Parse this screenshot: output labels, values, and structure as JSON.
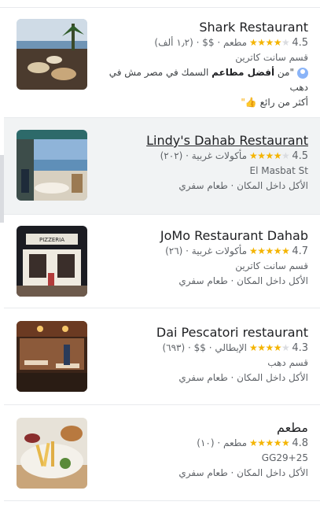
{
  "results": [
    {
      "name": "Shark Restaurant",
      "rating": "4.5",
      "stars_filled": 4.5,
      "meta": "مطعم · $$ · (١٫٢ ألف)",
      "line2": "قسم سانت كاترين",
      "review_pre": "\"من ",
      "review_bold": "أفضل مطاعم",
      "review_post": " السمك في مصر مش في دهب",
      "review_line2": "أكثر من رائع",
      "review_emoji": "👍\""
    },
    {
      "name": "Lindy's Dahab Restaurant",
      "rating": "4.5",
      "stars_filled": 4.5,
      "meta": "مأكولات غربية · (٢٠٢)",
      "line2": "El Masbat St",
      "line3": "الأكل داخل المكان · طعام سفري"
    },
    {
      "name": "JoMo Restaurant Dahab",
      "rating": "4.7",
      "stars_filled": 4.7,
      "meta": "مأكولات غربية · (٢٦)",
      "line2": "قسم سانت كاترين",
      "line3": "الأكل داخل المكان · طعام سفري"
    },
    {
      "name": "Dai Pescatori restaurant",
      "rating": "4.3",
      "stars_filled": 4.3,
      "meta": "الإيطالي · $$ · (٦٩٣)",
      "line2": "قسم دهب",
      "line3": "الأكل داخل المكان · طعام سفري"
    },
    {
      "name": "مطعم",
      "rating": "4.8",
      "stars_filled": 4.8,
      "meta": "مطعم · (١٠)",
      "line2": "GG29+25",
      "line3": "الأكل داخل المكان · طعام سفري"
    }
  ],
  "colors": {
    "star": "#f4b400",
    "highlight": "#f1f3f4",
    "link": "#202124"
  }
}
